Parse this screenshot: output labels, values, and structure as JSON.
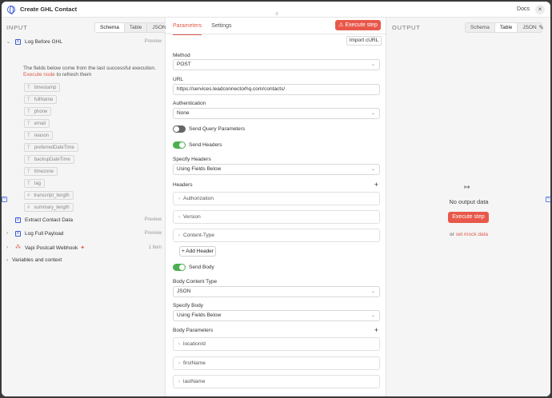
{
  "title": "Create GHL Contact",
  "docs_label": "Docs",
  "input": {
    "heading": "INPUT",
    "view_tabs": [
      "Schema",
      "Table",
      "JSON"
    ],
    "nodes": [
      {
        "name": "Log Before GHL",
        "right": "Preview",
        "expanded": true
      },
      {
        "name": "Extract Contact Data",
        "right": "Preview"
      },
      {
        "name": "Log Full Payload",
        "right": "Preview"
      },
      {
        "name": "Vapi Postcall Webhook",
        "right": "1 item"
      }
    ],
    "note_text": "The fields below come from the last successful execution.",
    "note_link": "Execute node",
    "note_suffix": " to refresh them",
    "fields": [
      {
        "type": "T",
        "name": "timestamp"
      },
      {
        "type": "T",
        "name": "fullName"
      },
      {
        "type": "T",
        "name": "phone"
      },
      {
        "type": "T",
        "name": "email"
      },
      {
        "type": "T",
        "name": "reason"
      },
      {
        "type": "T",
        "name": "preferredDateTime"
      },
      {
        "type": "T",
        "name": "backupDateTime"
      },
      {
        "type": "T",
        "name": "timezone"
      },
      {
        "type": "T",
        "name": "tag"
      },
      {
        "type": "#",
        "name": "transcript_length"
      },
      {
        "type": "#",
        "name": "summary_length"
      }
    ],
    "variables_label": "Variables and context"
  },
  "params": {
    "tabs": [
      "Parameters",
      "Settings"
    ],
    "execute_label": "Execute step",
    "import_label": "Import cURL",
    "method_label": "Method",
    "method_value": "POST",
    "url_label": "URL",
    "url_value": "https://services.leadconnectorhq.com/contacts/",
    "auth_label": "Authentication",
    "auth_value": "None",
    "send_query_label": "Send Query Parameters",
    "send_query_on": false,
    "send_headers_label": "Send Headers",
    "send_headers_on": true,
    "specify_headers_label": "Specify Headers",
    "specify_headers_value": "Using Fields Below",
    "headers_label": "Headers",
    "headers": [
      "Authorization",
      "Version",
      "Content-Type"
    ],
    "add_header_label": "+ Add Header",
    "send_body_label": "Send Body",
    "send_body_on": true,
    "body_content_type_label": "Body Content Type",
    "body_content_type_value": "JSON",
    "specify_body_label": "Specify Body",
    "specify_body_value": "Using Fields Below",
    "body_params_label": "Body Parameters",
    "body_params": [
      "locationId",
      "firstName",
      "lastName"
    ]
  },
  "output": {
    "heading": "OUTPUT",
    "view_tabs": [
      "Schema",
      "Table",
      "JSON"
    ],
    "active_tab": "Table",
    "no_data": "No output data",
    "execute_label": "Execute step",
    "or_text": "or",
    "mock_link": "set mock data"
  },
  "colors": {
    "accent": "#e8584a",
    "toggle_on": "#4caf50",
    "node_icon": "#3d5bd9"
  }
}
